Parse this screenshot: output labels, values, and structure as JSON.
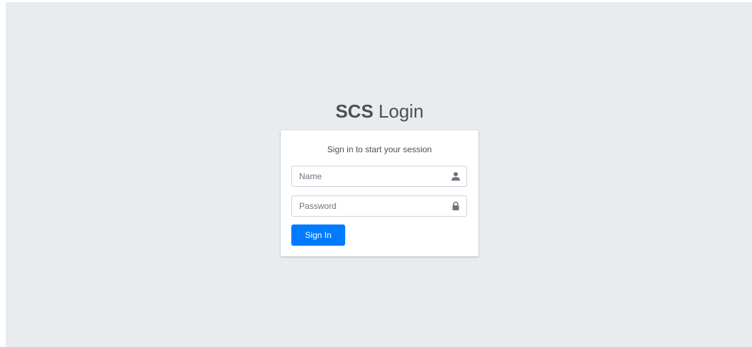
{
  "logo": {
    "bold": "SCS",
    "light": "Login"
  },
  "card": {
    "message": "Sign in to start your session",
    "name_field": {
      "placeholder": "Name",
      "icon": "user-icon"
    },
    "password_field": {
      "placeholder": "Password",
      "icon": "lock-icon"
    },
    "submit_label": "Sign In"
  },
  "colors": {
    "background": "#e9ecef",
    "primary": "#007bff",
    "icon": "#6c757d"
  }
}
